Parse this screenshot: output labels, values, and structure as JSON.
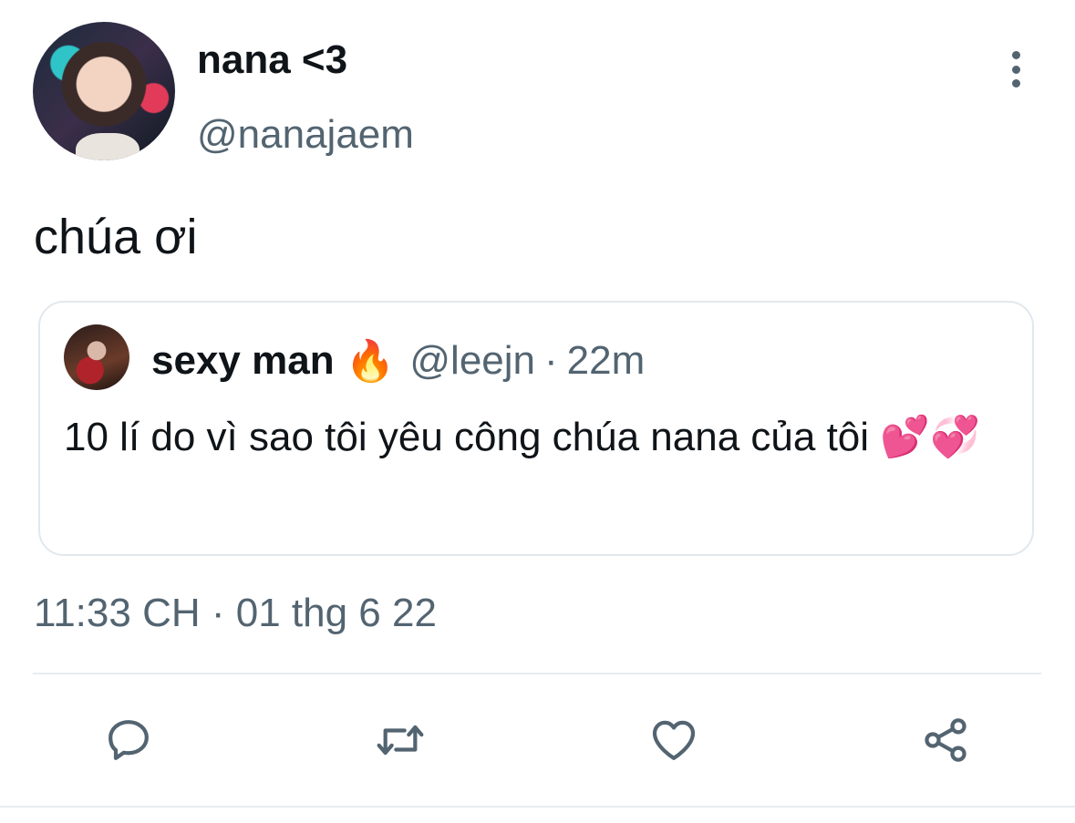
{
  "tweet": {
    "author_name": "nana <3",
    "author_handle": "@nanajaem",
    "text": "chúa ơi",
    "timestamp": "11:33 CH · 01 thg 6 22",
    "more_icon": "more-vertical-icon"
  },
  "quoted_tweet": {
    "author_name": "sexy man",
    "author_emoji": "🔥",
    "author_handle": "@leejn",
    "separator": "·",
    "time": "22m",
    "text": "10 lí do vì sao tôi yêu công chúa nana của tôi 💕💞"
  },
  "actions": [
    {
      "name": "reply",
      "icon": "reply-icon"
    },
    {
      "name": "retweet",
      "icon": "retweet-icon"
    },
    {
      "name": "like",
      "icon": "heart-icon"
    },
    {
      "name": "share",
      "icon": "share-icon"
    }
  ],
  "colors": {
    "text_primary": "#0f1419",
    "text_secondary": "#536471",
    "border": "#e1e8ed"
  }
}
